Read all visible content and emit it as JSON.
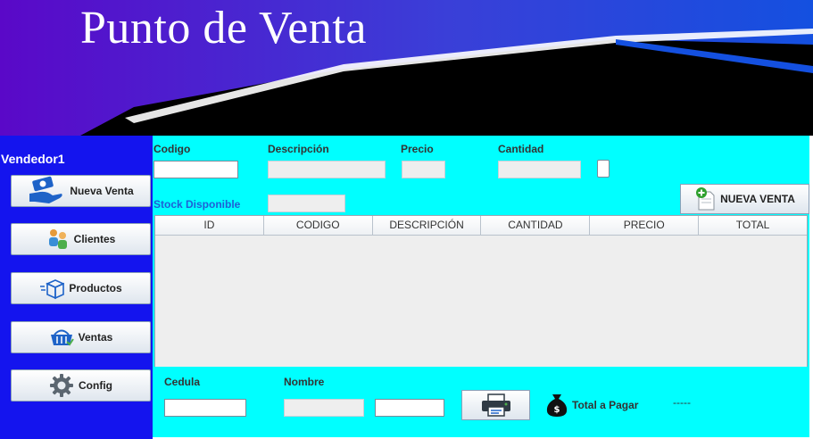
{
  "header": {
    "title": "Punto de Venta"
  },
  "sidebar": {
    "user": "Vendedor1",
    "items": [
      {
        "label": "Nueva Venta",
        "icon": "money-hand-icon"
      },
      {
        "label": "Clientes",
        "icon": "people-icon"
      },
      {
        "label": "Productos",
        "icon": "box-icon"
      },
      {
        "label": "Ventas",
        "icon": "basket-icon"
      },
      {
        "label": "Config",
        "icon": "gear-icon"
      }
    ]
  },
  "form": {
    "codigo_label": "Codigo",
    "codigo_value": "",
    "descripcion_label": "Descripción",
    "descripcion_value": "",
    "precio_label": "Precio",
    "precio_value": "",
    "cantidad_label": "Cantidad",
    "cantidad_value": "",
    "stock_label": "Stock Disponible",
    "stock_value": "",
    "new_sale_button": "NUEVA VENTA"
  },
  "table": {
    "columns": [
      "ID",
      "CODIGO",
      "DESCRIPCIÓN",
      "CANTIDAD",
      "PRECIO",
      "TOTAL"
    ],
    "rows": []
  },
  "footer": {
    "cedula_label": "Cedula",
    "cedula_value": "",
    "nombre_label": "Nombre",
    "nombre_value": "",
    "extra_value": "",
    "total_label": "Total a Pagar",
    "total_value": "-----"
  },
  "colors": {
    "sidebar": "#1414ee",
    "main_panel": "#00ffff",
    "header_dark": "#000000",
    "label_blue": "#1f5fd6"
  }
}
